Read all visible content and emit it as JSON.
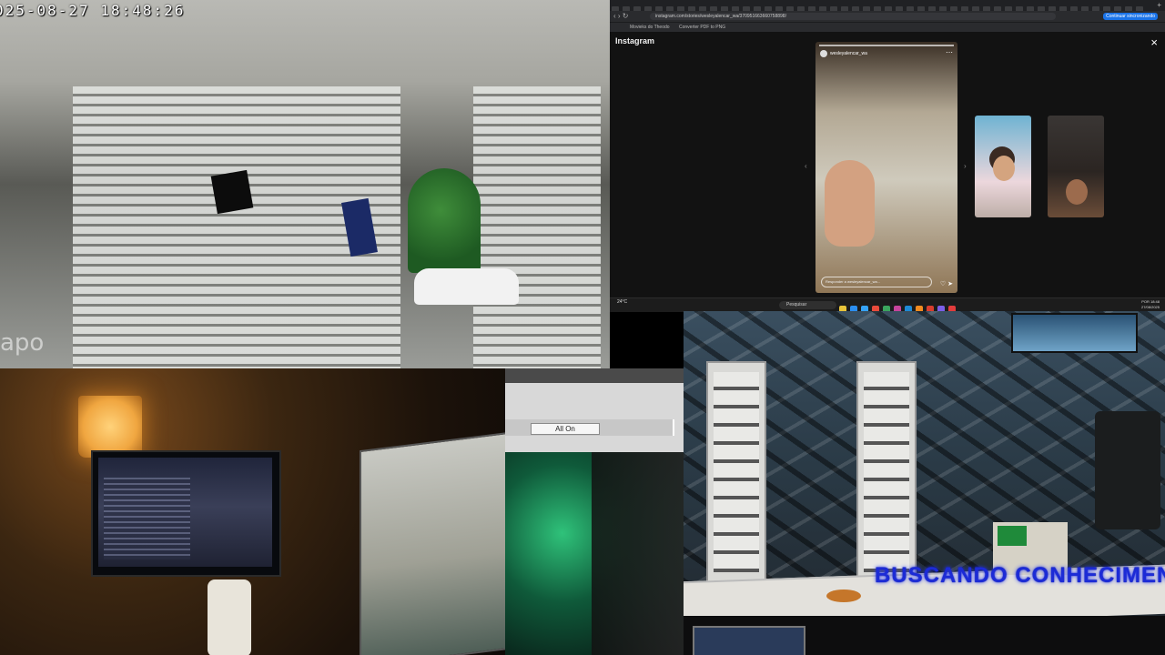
{
  "camera_top": {
    "timestamp": "025-08-27  18:48:26",
    "watermark": "apo"
  },
  "browser": {
    "url": "instagram.com/stories/wesleyalencar_wa/370951663660758898/",
    "sync_button": "Continuar sincronizando",
    "bookmarks": [
      "Movieks do Theodo",
      "Converter PDF to PNG"
    ],
    "site_logo": "Instagram",
    "close_glyph": "×",
    "story": {
      "username": "wesleyalencar_wa",
      "reply_placeholder": "Responder a wesleyalencar_wa...",
      "more_glyph": "⋯"
    }
  },
  "taskbar": {
    "weather": "24°C",
    "search_placeholder": "Pesquisar",
    "language": "POR",
    "clock_time": "18:48",
    "clock_date": "27/08/2025",
    "icon_colors": [
      "#e8c43a",
      "#2b8ef0",
      "#36a3f7",
      "#e84b3c",
      "#3ba55d",
      "#c6449c",
      "#1e8ad6",
      "#f28b20",
      "#d93d2e",
      "#7b5ee8",
      "#e23c3c"
    ]
  },
  "dialog": {
    "button_label": "All On"
  },
  "studio": {
    "overlay_text": "BUSCANDO CONHECIMENTO"
  }
}
